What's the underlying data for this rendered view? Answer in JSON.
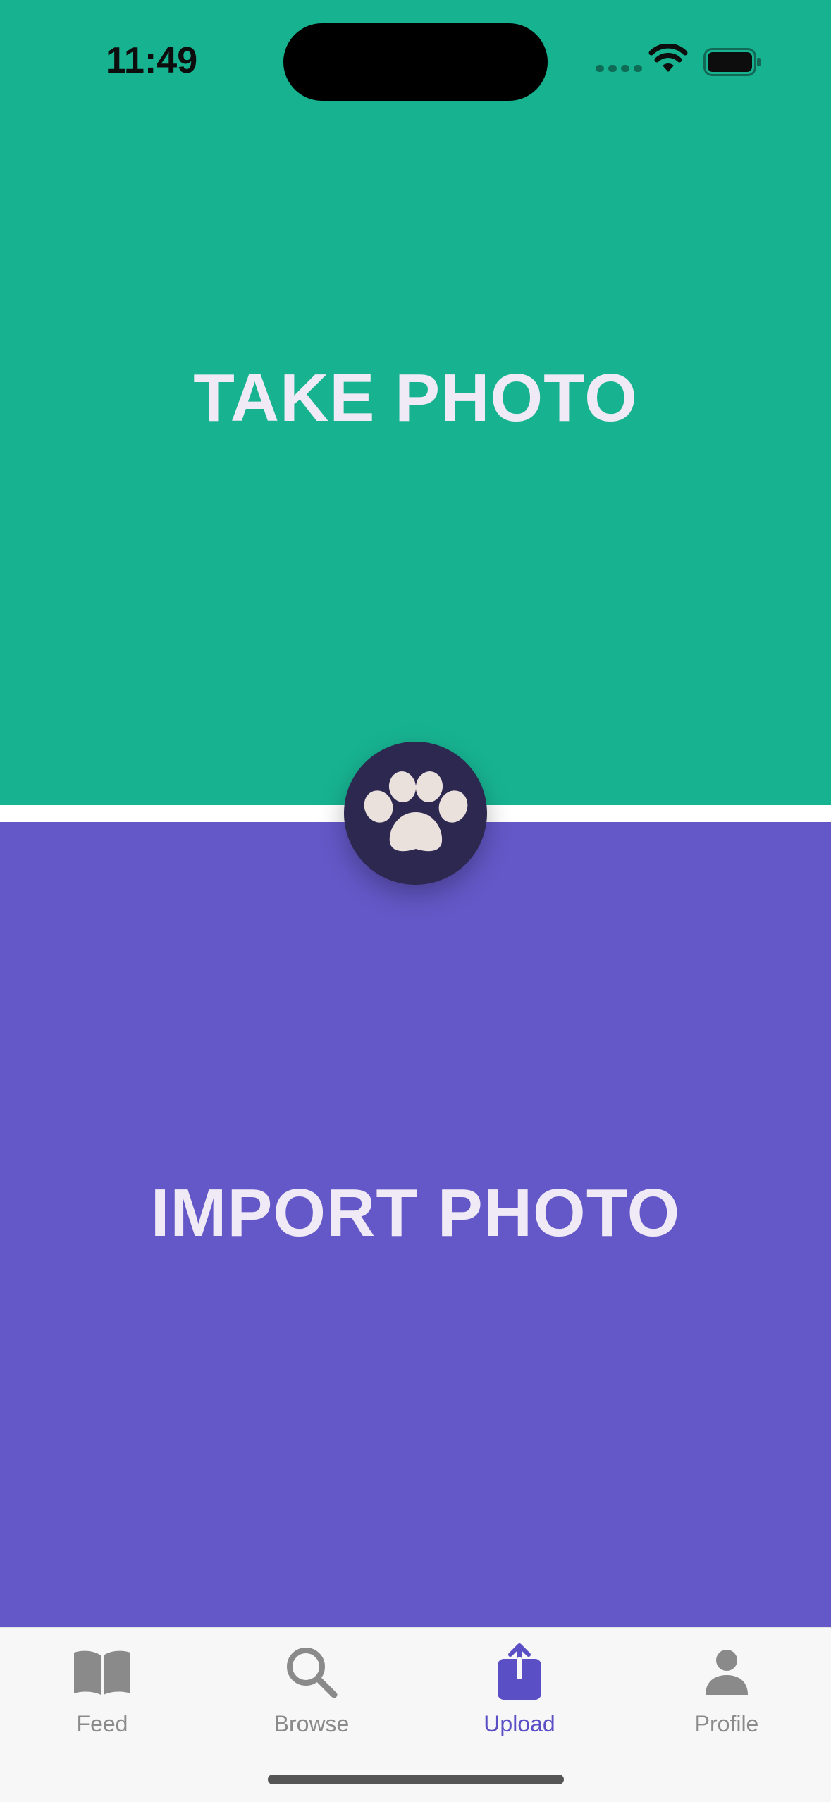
{
  "status_bar": {
    "time": "11:49"
  },
  "panels": {
    "take_photo_label": "TAKE PHOTO",
    "import_photo_label": "IMPORT PHOTO"
  },
  "center_button": {
    "icon": "paw-icon"
  },
  "tab_bar": {
    "items": [
      {
        "label": "Feed",
        "icon": "book-icon",
        "active": false
      },
      {
        "label": "Browse",
        "icon": "search-icon",
        "active": false
      },
      {
        "label": "Upload",
        "icon": "upload-icon",
        "active": true
      },
      {
        "label": "Profile",
        "icon": "person-icon",
        "active": false
      }
    ]
  },
  "colors": {
    "take_panel": "#17b391",
    "import_panel": "#6458c8",
    "paw_button": "#2d2850",
    "paw": "#eae0dc",
    "tab_active": "#5b4fc6",
    "tab_inactive": "#8a8a8a"
  }
}
